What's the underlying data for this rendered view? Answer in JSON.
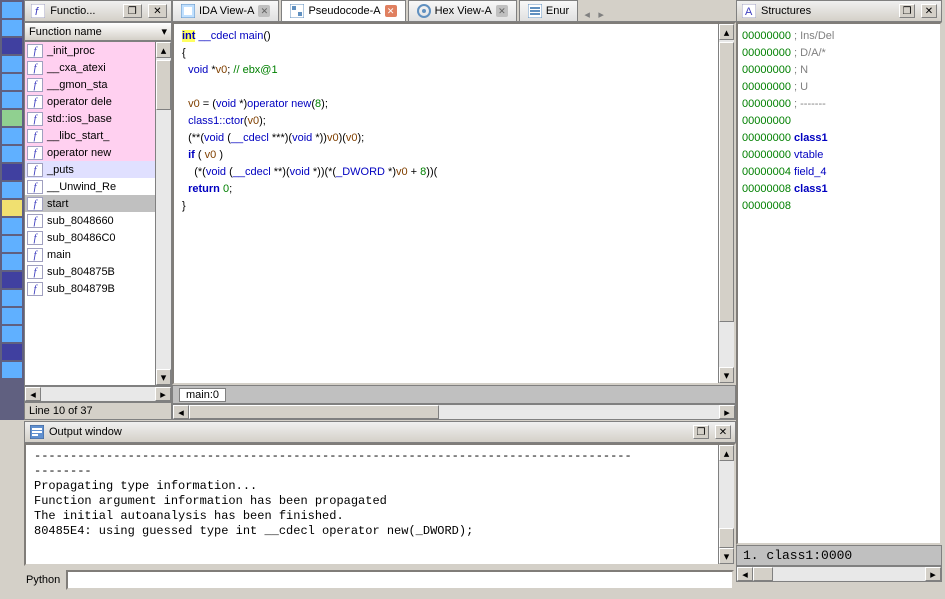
{
  "functions": {
    "title": "Functio...",
    "col_header": "Function name",
    "items": [
      {
        "label": "_init_proc",
        "cls": "pink"
      },
      {
        "label": "__cxa_atexi",
        "cls": "pink"
      },
      {
        "label": "__gmon_sta",
        "cls": "pink"
      },
      {
        "label": "operator dele",
        "cls": "pink"
      },
      {
        "label": "std::ios_base",
        "cls": "pink"
      },
      {
        "label": "__libc_start_",
        "cls": "pink"
      },
      {
        "label": "operator new",
        "cls": "pink"
      },
      {
        "label": "_puts",
        "cls": "hi"
      },
      {
        "label": "__Unwind_Re",
        "cls": ""
      },
      {
        "label": "start",
        "cls": "sel"
      },
      {
        "label": "sub_8048660",
        "cls": ""
      },
      {
        "label": "sub_80486C0",
        "cls": ""
      },
      {
        "label": "main",
        "cls": ""
      },
      {
        "label": "sub_804875B",
        "cls": ""
      },
      {
        "label": "sub_804879B",
        "cls": ""
      }
    ],
    "status": "Line 10 of 37"
  },
  "tabs": {
    "items": [
      {
        "label": "IDA View-A",
        "icon": "ida",
        "active": false,
        "closable": true
      },
      {
        "label": "Pseudocode-A",
        "icon": "pseudo",
        "active": true,
        "closable": true
      },
      {
        "label": "Hex View-A",
        "icon": "hex",
        "active": false,
        "closable": true
      },
      {
        "label": "Enur",
        "icon": "enum",
        "active": false,
        "closable": false,
        "truncated": true
      }
    ]
  },
  "code": {
    "footer": "main:0"
  },
  "structures": {
    "title": "Structures",
    "lines": [
      {
        "addr": "00000000",
        "text": "; Ins/Del"
      },
      {
        "addr": "00000000",
        "text": "; D/A/*"
      },
      {
        "addr": "00000000",
        "text": "; N"
      },
      {
        "addr": "00000000",
        "text": "; U"
      },
      {
        "addr": "00000000",
        "text": "; -------"
      },
      {
        "addr": "00000000",
        "text": ""
      },
      {
        "addr": "00000000",
        "name": "class1"
      },
      {
        "addr": "00000000",
        "field": "vtable"
      },
      {
        "addr": "00000004",
        "field": "field_4"
      },
      {
        "addr": "00000008",
        "name": "class1"
      },
      {
        "addr": "00000008",
        "text": ""
      }
    ],
    "footer": "1. class1:0000"
  },
  "output": {
    "title": "Output window",
    "lines": [
      "--------",
      "Propagating type information...",
      "Function argument information has been propagated",
      "The initial autoanalysis has been finished.",
      "80485E4: using guessed type int __cdecl operator new(_DWORD);"
    ]
  },
  "python": {
    "label": "Python",
    "value": ""
  }
}
